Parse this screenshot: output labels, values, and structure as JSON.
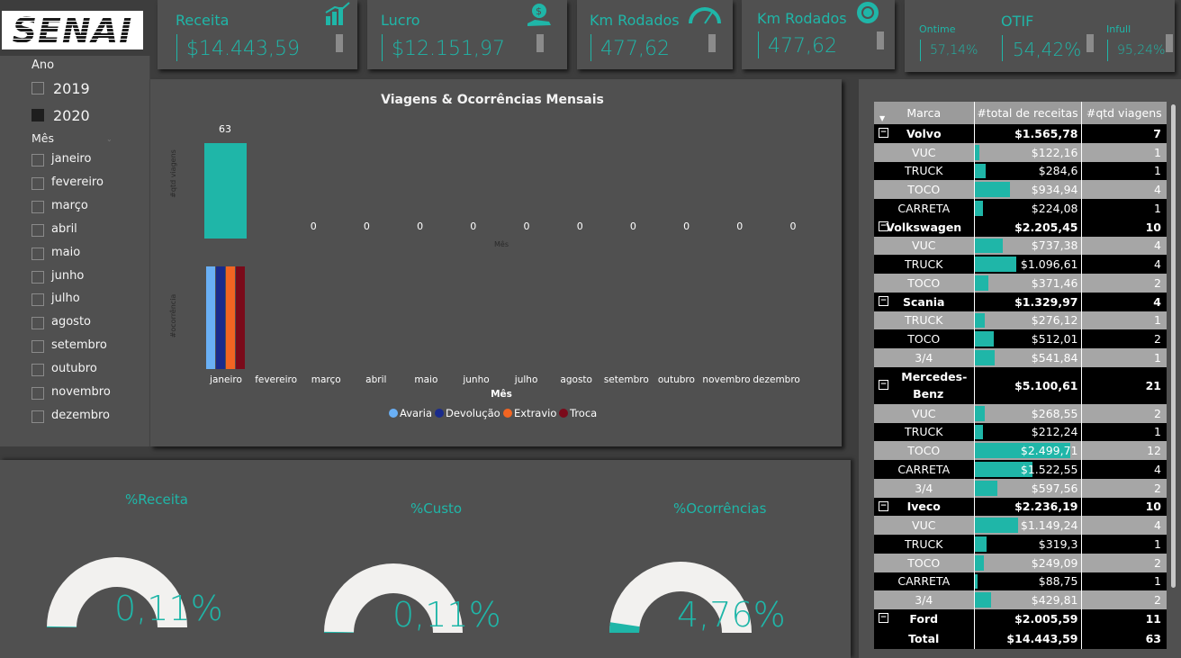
{
  "logo": {
    "text": "SENAI"
  },
  "filters": {
    "ano_label": "Ano",
    "years": [
      {
        "label": "2019",
        "checked": false
      },
      {
        "label": "2020",
        "checked": true
      }
    ],
    "mes_label": "Mês",
    "months": [
      "janeiro",
      "fevereiro",
      "março",
      "abril",
      "maio",
      "junho",
      "julho",
      "agosto",
      "setembro",
      "outubro",
      "novembro",
      "dezembro"
    ]
  },
  "kpis": {
    "receita": {
      "title": "Receita",
      "value": "$14.443,59"
    },
    "lucro": {
      "title": "Lucro",
      "value": "$12.151,97"
    },
    "km1": {
      "title": "Km Rodados",
      "value": "477,62"
    },
    "km2": {
      "title": "Km Rodados",
      "value": "477,62"
    },
    "ontime": {
      "title": "Ontime",
      "value": "57,14%"
    },
    "otif": {
      "title": "OTIF",
      "value": "54,42%"
    },
    "infull": {
      "title": "Infull",
      "value": "95,24%"
    }
  },
  "colors": {
    "accent": "#1fb6a8",
    "avaria": "#6ab0f5",
    "devolucao": "#1a2b8c",
    "extravio": "#f26522",
    "troca": "#7a0a1a"
  },
  "chart_data": {
    "title": "Viagens & Ocorrências Mensais",
    "top": {
      "type": "bar",
      "ylabel": "#qtd viagens",
      "xlabel": "Mês",
      "categories": [
        "janeiro",
        "fevereiro",
        "março",
        "abril",
        "maio",
        "junho",
        "julho",
        "agosto",
        "setembro",
        "outubro",
        "novembro",
        "dezembro"
      ],
      "values": [
        63,
        0,
        0,
        0,
        0,
        0,
        0,
        0,
        0,
        0,
        0,
        0
      ]
    },
    "bottom": {
      "type": "bar",
      "ylabel": "#ocorrência",
      "xlabel": "Mês",
      "categories": [
        "janeiro",
        "fevereiro",
        "março",
        "abril",
        "maio",
        "junho",
        "julho",
        "agosto",
        "setembro",
        "outubro",
        "novembro",
        "dezembro"
      ],
      "series": [
        {
          "name": "Avaria",
          "values": [
            1,
            0,
            0,
            0,
            0,
            0,
            0,
            0,
            0,
            0,
            0,
            0
          ]
        },
        {
          "name": "Devolução",
          "values": [
            1,
            0,
            0,
            0,
            0,
            0,
            0,
            0,
            0,
            0,
            0,
            0
          ]
        },
        {
          "name": "Extravio",
          "values": [
            1,
            0,
            0,
            0,
            0,
            0,
            0,
            0,
            0,
            0,
            0,
            0
          ]
        },
        {
          "name": "Troca",
          "values": [
            1,
            0,
            0,
            0,
            0,
            0,
            0,
            0,
            0,
            0,
            0,
            0
          ]
        }
      ]
    }
  },
  "table": {
    "headers": [
      "Marca",
      "#total de receitas",
      "#qtd viagens"
    ],
    "max_receita": 2499.71,
    "rows": [
      {
        "type": "grp",
        "marca": "Volvo",
        "receita": "$1.565,78",
        "qtd": "7"
      },
      {
        "type": "lt",
        "marca": "VUC",
        "receita": "$122,16",
        "qtd": "1",
        "num": 122.16
      },
      {
        "type": "dk",
        "marca": "TRUCK",
        "receita": "$284,6",
        "qtd": "1",
        "num": 284.6
      },
      {
        "type": "lt",
        "marca": "TOCO",
        "receita": "$934,94",
        "qtd": "4",
        "num": 934.94
      },
      {
        "type": "dk",
        "marca": "CARRETA",
        "receita": "$224,08",
        "qtd": "1",
        "num": 224.08
      },
      {
        "type": "grp",
        "marca": "Volkswagen",
        "receita": "$2.205,45",
        "qtd": "10"
      },
      {
        "type": "lt",
        "marca": "VUC",
        "receita": "$737,38",
        "qtd": "4",
        "num": 737.38
      },
      {
        "type": "dk",
        "marca": "TRUCK",
        "receita": "$1.096,61",
        "qtd": "4",
        "num": 1096.61
      },
      {
        "type": "lt",
        "marca": "TOCO",
        "receita": "$371,46",
        "qtd": "2",
        "num": 371.46
      },
      {
        "type": "grp",
        "marca": "Scania",
        "receita": "$1.329,97",
        "qtd": "4"
      },
      {
        "type": "lt",
        "marca": "TRUCK",
        "receita": "$276,12",
        "qtd": "1",
        "num": 276.12
      },
      {
        "type": "dk",
        "marca": "TOCO",
        "receita": "$512,01",
        "qtd": "2",
        "num": 512.01
      },
      {
        "type": "lt",
        "marca": "3/4",
        "receita": "$541,84",
        "qtd": "1",
        "num": 541.84
      },
      {
        "type": "grp2",
        "marca": "Mercedes-Benz",
        "receita": "$5.100,61",
        "qtd": "21"
      },
      {
        "type": "lt",
        "marca": "VUC",
        "receita": "$268,55",
        "qtd": "2",
        "num": 268.55
      },
      {
        "type": "dk",
        "marca": "TRUCK",
        "receita": "$212,24",
        "qtd": "1",
        "num": 212.24
      },
      {
        "type": "lt",
        "marca": "TOCO",
        "receita": "$2.499,71",
        "qtd": "12",
        "num": 2499.71
      },
      {
        "type": "dk",
        "marca": "CARRETA",
        "receita": "$1.522,55",
        "qtd": "4",
        "num": 1522.55
      },
      {
        "type": "lt",
        "marca": "3/4",
        "receita": "$597,56",
        "qtd": "2",
        "num": 597.56
      },
      {
        "type": "grp",
        "marca": "Iveco",
        "receita": "$2.236,19",
        "qtd": "10"
      },
      {
        "type": "lt",
        "marca": "VUC",
        "receita": "$1.149,24",
        "qtd": "4",
        "num": 1149.24
      },
      {
        "type": "dk",
        "marca": "TRUCK",
        "receita": "$319,3",
        "qtd": "1",
        "num": 319.3
      },
      {
        "type": "lt",
        "marca": "TOCO",
        "receita": "$249,09",
        "qtd": "2",
        "num": 249.09
      },
      {
        "type": "dk",
        "marca": "CARRETA",
        "receita": "$88,75",
        "qtd": "1",
        "num": 88.75
      },
      {
        "type": "lt",
        "marca": "3/4",
        "receita": "$429,81",
        "qtd": "2",
        "num": 429.81
      },
      {
        "type": "grp",
        "marca": "Ford",
        "receita": "$2.005,59",
        "qtd": "11"
      }
    ],
    "total": {
      "marca": "Total",
      "receita": "$14.443,59",
      "qtd": "63"
    }
  },
  "gauges": [
    {
      "title": "%Receita",
      "value": "0,11%",
      "pct": 0.0011
    },
    {
      "title": "%Custo",
      "value": "0,11%",
      "pct": 0.0011
    },
    {
      "title": "%Ocorrências",
      "value": "4,76%",
      "pct": 0.0476
    }
  ]
}
